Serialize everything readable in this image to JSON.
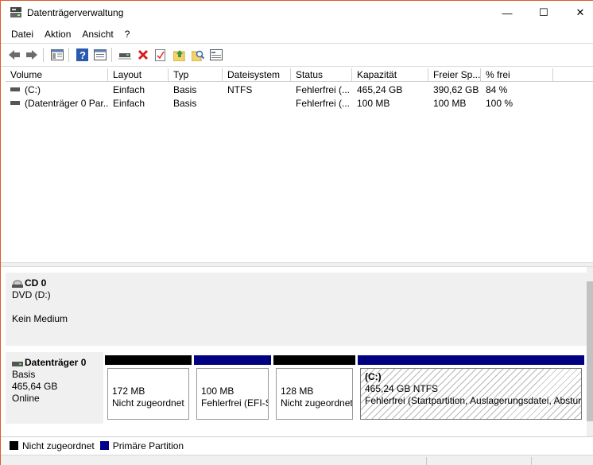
{
  "window": {
    "title": "Datenträgerverwaltung",
    "minimize_glyph": "—",
    "maximize_glyph": "☐",
    "close_glyph": "✕"
  },
  "menu": [
    "Datei",
    "Aktion",
    "Ansicht",
    "?"
  ],
  "toolbar": {
    "icons": [
      "back-icon",
      "forward-icon",
      "console-tree-icon",
      "help-icon",
      "properties-icon",
      "connect-disk-icon",
      "delete-icon",
      "check-icon",
      "open-folder-icon",
      "search-icon",
      "settings-icon"
    ]
  },
  "table": {
    "columns": [
      "Volume",
      "Layout",
      "Typ",
      "Dateisystem",
      "Status",
      "Kapazität",
      "Freier Sp...",
      "% frei"
    ],
    "rows": [
      {
        "volume": "(C:)",
        "layout": "Einfach",
        "typ": "Basis",
        "dateisystem": "NTFS",
        "status": "Fehlerfrei (...",
        "kapazitaet": "465,24 GB",
        "frei": "390,62 GB",
        "prozent": "84 %"
      },
      {
        "volume": "(Datenträger 0 Par...",
        "layout": "Einfach",
        "typ": "Basis",
        "dateisystem": "",
        "status": "Fehlerfrei (...",
        "kapazitaet": "100 MB",
        "frei": "100 MB",
        "prozent": "100 %"
      }
    ]
  },
  "disks": {
    "cd0": {
      "title": "CD 0",
      "line1": "DVD (D:)",
      "line2": "",
      "line3": "Kein Medium"
    },
    "disk0": {
      "title": "Datenträger 0",
      "line1": "Basis",
      "line2": "465,64 GB",
      "line3": "Online",
      "partitions": [
        {
          "name": "",
          "size": "172 MB",
          "status": "Nicht zugeordnet",
          "type": "unallocated"
        },
        {
          "name": "",
          "size": "100 MB",
          "status": "Fehlerfrei (EFI-Sy",
          "type": "primary"
        },
        {
          "name": "",
          "size": "128 MB",
          "status": "Nicht zugeordnet",
          "type": "unallocated"
        },
        {
          "name": "(C:)",
          "size": "465,24 GB NTFS",
          "status": "Fehlerfrei (Startpartition, Auslagerungsdatei, Abstur",
          "type": "primary"
        }
      ]
    }
  },
  "legend": [
    {
      "label": "Nicht zugeordnet",
      "color": "#000000"
    },
    {
      "label": "Primäre Partition",
      "color": "#00008b"
    }
  ],
  "colors": {
    "unallocated": "#000000",
    "primary": "#000080"
  }
}
